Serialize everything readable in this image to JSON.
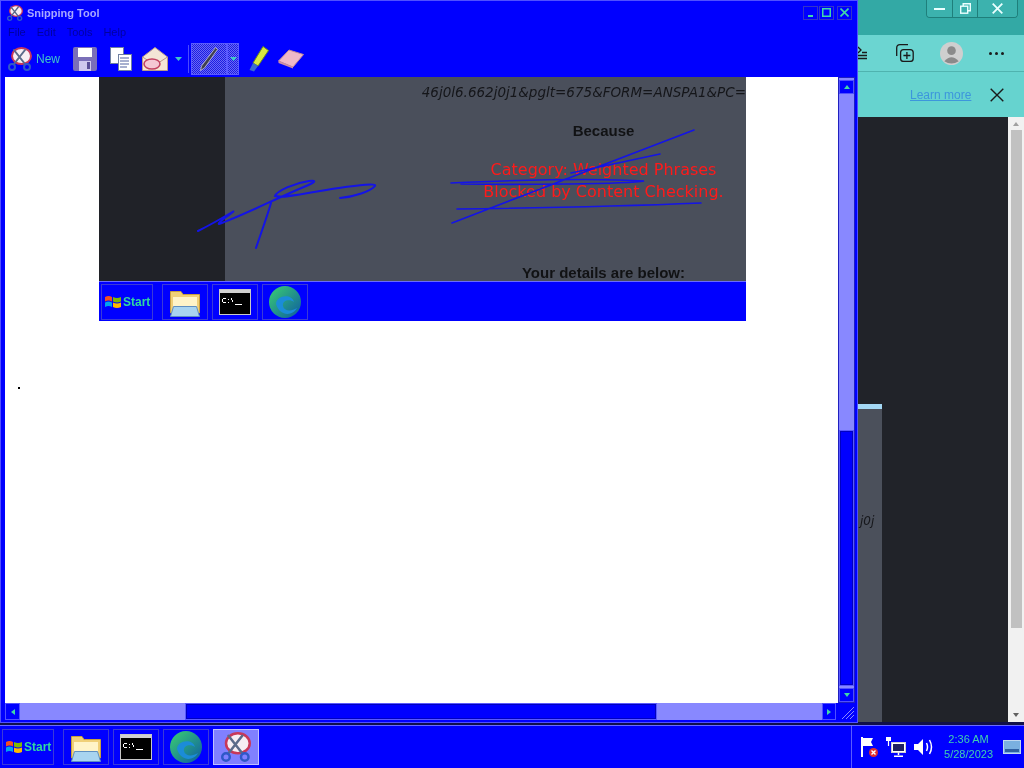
{
  "window": {
    "title": "Snipping Tool"
  },
  "menu": [
    "File",
    "Edit",
    "Tools",
    "Help"
  ],
  "toolbar": {
    "new_label": "New",
    "tools": [
      {
        "kind": "pen",
        "selected": true
      },
      {
        "kind": "highlighter",
        "selected": false
      },
      {
        "kind": "eraser",
        "selected": false
      }
    ]
  },
  "snip": {
    "url_fragment": "46j0l6.662j0j1&pglt=675&FORM=ANSPA1&PC=",
    "heading": "Because",
    "block_lines": [
      "Category: Weighted Phrases",
      "Blocked by Content Checking."
    ],
    "details_heading": "Your details are below:",
    "taskbar": {
      "start_label": "Start",
      "apps": [
        {
          "kind": "folder"
        },
        {
          "kind": "terminal"
        },
        {
          "kind": "browser"
        }
      ]
    }
  },
  "browser": {
    "info_link": "Learn more",
    "page_fragment": "j0j"
  },
  "taskbar": {
    "start_label": "Start",
    "apps": [
      {
        "kind": "folder",
        "selected": false
      },
      {
        "kind": "terminal",
        "selected": false
      },
      {
        "kind": "browser",
        "selected": false
      },
      {
        "kind": "snipping",
        "selected": true
      }
    ],
    "clock": {
      "time": "2:36 AM",
      "date": "5/28/2023"
    }
  }
}
